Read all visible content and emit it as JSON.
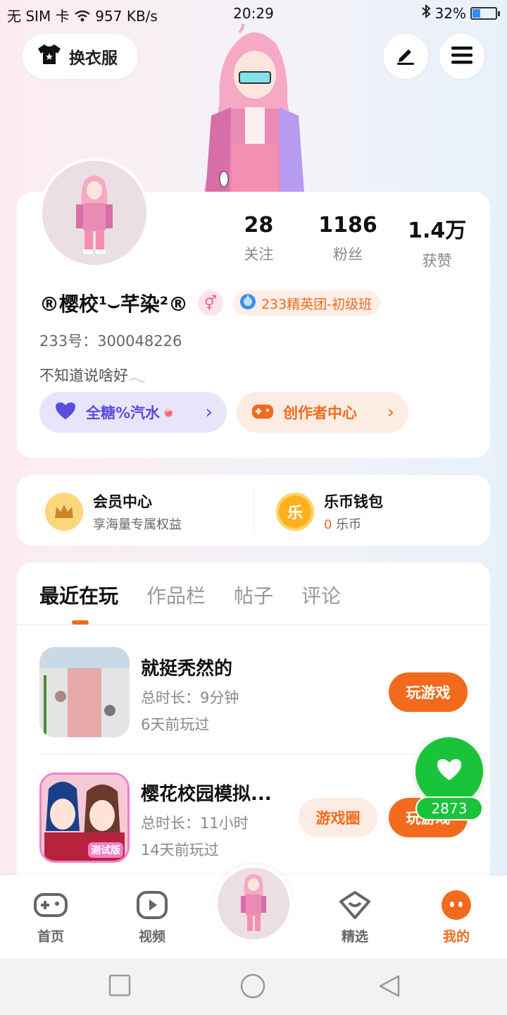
{
  "status_bar": {
    "carrier": "无 SIM 卡",
    "speed": "957 KB/s",
    "time": "20:29",
    "battery_text": "32%",
    "battery_level": 0.32
  },
  "header": {
    "wardrobe_label": "换衣服",
    "icons": [
      "shirt-icon",
      "edit-icon",
      "menu-icon"
    ]
  },
  "profile": {
    "stats": [
      {
        "value": "28",
        "label": "关注"
      },
      {
        "value": "1186",
        "label": "粉丝"
      },
      {
        "value": "1.4万",
        "label": "获赞"
      }
    ],
    "name": "®樱校¹⌣芊染²®",
    "gender_symbol": "⚥",
    "rank_badge": "233精英团-初级班",
    "id_line": "233号：300048226",
    "bio": "不知道说啥好𓂃",
    "pill_left": "全糖%汽水🍬",
    "pill_right": "创作者中心"
  },
  "member": {
    "vip_title": "会员中心",
    "vip_sub": "享海量专属权益",
    "wallet_title": "乐币钱包",
    "wallet_amount": "0",
    "wallet_unit": "乐币",
    "wallet_coin_char": "乐"
  },
  "tabs": [
    "最近在玩",
    "作品栏",
    "帖子",
    "评论"
  ],
  "games": [
    {
      "title": "就挺秃然的",
      "duration": "总时长：9分钟",
      "last_played": "6天前玩过",
      "play_label": "玩游戏"
    },
    {
      "title": "樱花校园模拟...",
      "duration": "总时长：11小时",
      "last_played": "14天前玩过",
      "play_label": "玩游戏",
      "circle_label": "游戏圈",
      "thumb_badge": "测试版"
    }
  ],
  "like": {
    "count": "2873"
  },
  "bottom_nav": [
    {
      "label": "首页",
      "icon": "gamepad-icon"
    },
    {
      "label": "视频",
      "icon": "video-icon"
    },
    {
      "label": "精选",
      "icon": "heart-box-icon"
    },
    {
      "label": "我的",
      "icon": "me-icon"
    }
  ],
  "colors": {
    "accent": "#f26a1b",
    "purple": "#5b4ddb",
    "like_green": "#19c43a"
  }
}
